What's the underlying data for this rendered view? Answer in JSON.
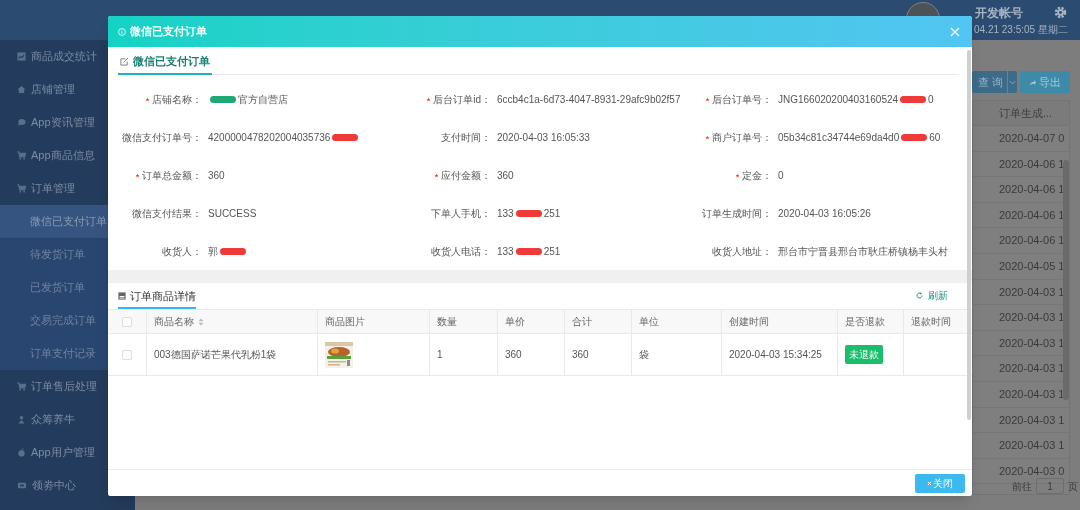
{
  "header": {
    "account": "开发帐号",
    "datetime": "04.21 23:5:05 星期二"
  },
  "sidebar": {
    "items": [
      {
        "label": "商品成交统计"
      },
      {
        "label": "店铺管理"
      },
      {
        "label": "App资讯管理"
      },
      {
        "label": "App商品信息"
      },
      {
        "label": "订单管理",
        "children": [
          {
            "label": "微信已支付订单",
            "selected": true
          },
          {
            "label": "待发货订单",
            "selected": false
          },
          {
            "label": "已发货订单",
            "selected": false
          },
          {
            "label": "交易完成订单",
            "selected": false
          },
          {
            "label": "订单支付记录",
            "selected": false
          }
        ]
      },
      {
        "label": "订单售后处理"
      },
      {
        "label": "众筹养牛"
      },
      {
        "label": "App用户管理"
      },
      {
        "label": "领劵中心"
      }
    ]
  },
  "background": {
    "query_button": "查 询",
    "export_button": "导出",
    "column_header": "订单生成...",
    "dates": [
      "2020-04-07 0",
      "2020-04-06 1",
      "2020-04-06 1",
      "2020-04-06 1",
      "2020-04-06 1",
      "2020-04-05 1",
      "2020-04-03 1",
      "2020-04-03 1",
      "2020-04-03 1",
      "2020-04-03 1",
      "2020-04-03 1",
      "2020-04-03 1",
      "2020-04-03 1",
      "2020-04-03 0"
    ],
    "goto_label": "前往",
    "page_input": "1",
    "page_suffix": "页"
  },
  "modal": {
    "title": "微信已支付订单",
    "tab": "微信已支付订单",
    "fields": [
      {
        "label": "店铺名称：",
        "required": true,
        "value": [
          {
            "kind": "redaction",
            "color": "#1fa774"
          },
          {
            "kind": "text",
            "text": "官方自营店"
          }
        ]
      },
      {
        "label": "后台订单id：",
        "required": true,
        "value": [
          {
            "kind": "text",
            "text": "6ccb4c1a-6d73-4047-8931-29afc9b02f57"
          }
        ]
      },
      {
        "label": "后台订单号：",
        "required": true,
        "value": [
          {
            "kind": "text",
            "text": "JNG166020200403160524"
          },
          {
            "kind": "redaction",
            "color": "#f03a3a"
          },
          {
            "kind": "text",
            "text": "0"
          }
        ]
      },
      {
        "label": "微信支付订单号：",
        "required": false,
        "value": [
          {
            "kind": "text",
            "text": "4200000478202004035736"
          },
          {
            "kind": "redaction",
            "color": "#f03a3a"
          }
        ]
      },
      {
        "label": "支付时间：",
        "required": false,
        "value": [
          {
            "kind": "text",
            "text": "2020-04-03 16:05:33"
          }
        ]
      },
      {
        "label": "商户订单号：",
        "required": true,
        "value": [
          {
            "kind": "text",
            "text": "05b34c81c34744e69da4d0"
          },
          {
            "kind": "redaction",
            "color": "#f03a3a"
          },
          {
            "kind": "text",
            "text": "60"
          }
        ]
      },
      {
        "label": "订单总金额：",
        "required": true,
        "value": [
          {
            "kind": "text",
            "text": "360"
          }
        ]
      },
      {
        "label": "应付金额：",
        "required": true,
        "value": [
          {
            "kind": "text",
            "text": "360"
          }
        ]
      },
      {
        "label": "定金：",
        "required": true,
        "value": [
          {
            "kind": "text",
            "text": "0"
          }
        ]
      },
      {
        "label": "微信支付结果：",
        "required": false,
        "value": [
          {
            "kind": "text",
            "text": "SUCCESS"
          }
        ]
      },
      {
        "label": "下单人手机：",
        "required": false,
        "value": [
          {
            "kind": "text",
            "text": "133"
          },
          {
            "kind": "redaction",
            "color": "#f03a3a"
          },
          {
            "kind": "text",
            "text": "251"
          }
        ]
      },
      {
        "label": "订单生成时间：",
        "required": false,
        "value": [
          {
            "kind": "text",
            "text": "2020-04-03 16:05:26"
          }
        ]
      },
      {
        "label": "收货人：",
        "required": false,
        "value": [
          {
            "kind": "text",
            "text": "郭"
          },
          {
            "kind": "redaction",
            "color": "#f03a3a"
          }
        ]
      },
      {
        "label": "收货人电话：",
        "required": false,
        "value": [
          {
            "kind": "text",
            "text": "133"
          },
          {
            "kind": "redaction",
            "color": "#f03a3a"
          },
          {
            "kind": "text",
            "text": "251"
          }
        ]
      },
      {
        "label": "收货人地址：",
        "required": false,
        "value": [
          {
            "kind": "text",
            "text": "邢台市宁晋县邢台市耿庄桥镇杨丰头村"
          }
        ]
      }
    ],
    "detail_title": "订单商品详情",
    "refresh": "刷新",
    "table": {
      "select_all_checked": false,
      "columns": [
        {
          "label": "商品名称",
          "sortable": true
        },
        {
          "label": "商品图片",
          "sortable": false
        },
        {
          "label": "数量",
          "sortable": false
        },
        {
          "label": "单价",
          "sortable": false
        },
        {
          "label": "合计",
          "sortable": false
        },
        {
          "label": "单位",
          "sortable": false
        },
        {
          "label": "创建时间",
          "sortable": false
        },
        {
          "label": "是否退款",
          "sortable": false
        },
        {
          "label": "退款时间",
          "sortable": false
        }
      ],
      "rows": [
        {
          "checked": false,
          "name": "003德国萨诺芒果代乳粉1袋",
          "quantity": "1",
          "unit_price": "360",
          "total": "360",
          "unit": "袋",
          "created": "2020-04-03 15:34:25",
          "refund_status": {
            "text": "未退款",
            "color": "#19be6b"
          }
        }
      ]
    },
    "close_button": "关闭"
  }
}
